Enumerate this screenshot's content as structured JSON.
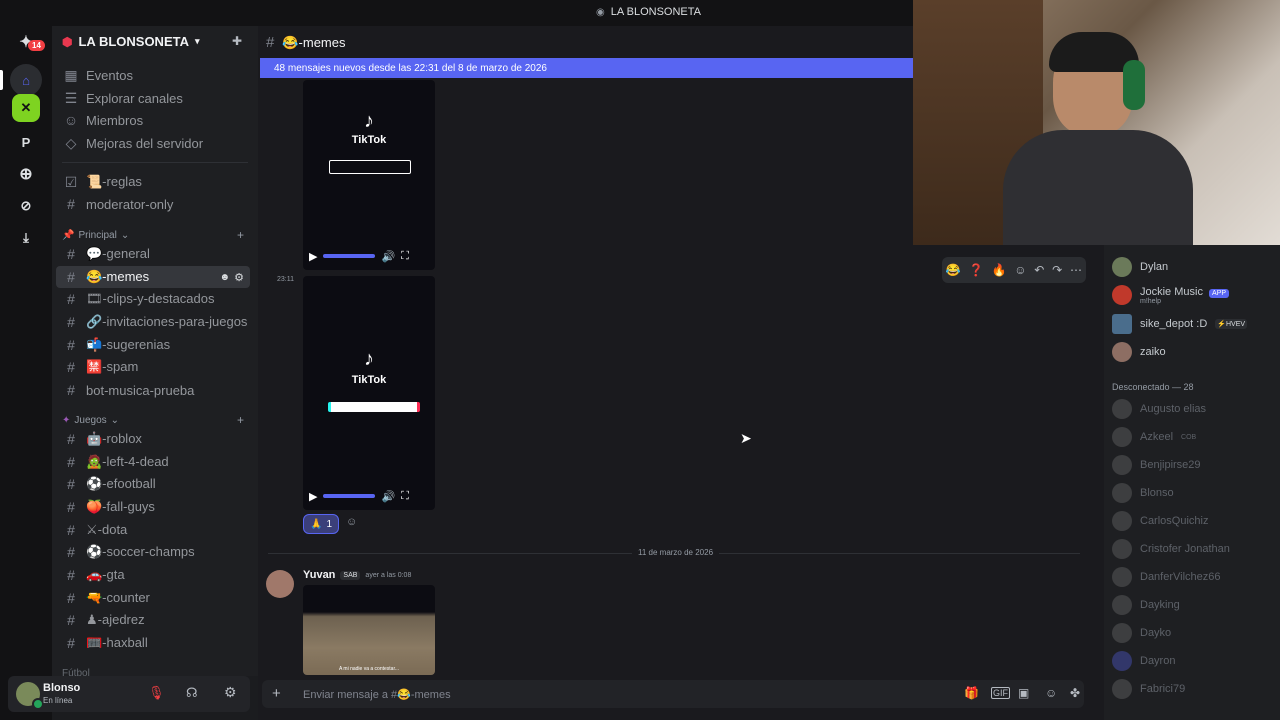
{
  "window": {
    "title": "LA BLONSONETA"
  },
  "servers": {
    "badge": "14",
    "items": [
      "P"
    ]
  },
  "guild": {
    "name": "LA BLONSONETA"
  },
  "nav": [
    {
      "label": "Eventos",
      "icon": "calendar-icon"
    },
    {
      "label": "Explorar canales",
      "icon": "list-icon"
    },
    {
      "label": "Miembros",
      "icon": "members-icon"
    },
    {
      "label": "Mejoras del servidor",
      "icon": "boost-icon"
    }
  ],
  "top_channels": [
    {
      "label": "📜-reglas"
    },
    {
      "label": "moderator-only"
    }
  ],
  "categories": {
    "principal": "Principal",
    "juegos": "Juegos",
    "futbol": "Fútbol"
  },
  "principal_channels": [
    {
      "label": "💬-general"
    },
    {
      "label": "😂-memes"
    },
    {
      "label": "🎞-clips-y-destacados"
    },
    {
      "label": "🔗-invitaciones-para-juegos"
    },
    {
      "label": "📬-sugerenias"
    },
    {
      "label": "🈲-spam"
    },
    {
      "label": "bot-musica-prueba"
    }
  ],
  "juegos_channels": [
    {
      "label": "🤖-roblox"
    },
    {
      "label": "🧟-left-4-dead"
    },
    {
      "label": "⚽-efootball"
    },
    {
      "label": "🍑-fall-guys"
    },
    {
      "label": "⚔-dota"
    },
    {
      "label": "⚽-soccer-champs"
    },
    {
      "label": "🚗-gta"
    },
    {
      "label": "🔫-counter"
    },
    {
      "label": "♟-ajedrez"
    },
    {
      "label": "🥅-haxball"
    }
  ],
  "user": {
    "name": "Blonso",
    "status": "En línea"
  },
  "channel": {
    "name": "😂-memes"
  },
  "banner": "48 mensajes nuevos desde las 22:31 del 8 de marzo de 2026",
  "messages": {
    "video_label": "TikTok",
    "timestamp": "23:11",
    "reaction_emoji": "🙏",
    "reaction_count": "1",
    "date_divider": "11 de marzo de 2026",
    "author": "Yuvan",
    "author_tag": "SAB",
    "author_time": "ayer a las 0:08",
    "caption": "A mi nadie va a contestar..."
  },
  "hover_actions": [
    "😂",
    "❓",
    "🔥"
  ],
  "composer": {
    "placeholder": "Enviar mensaje a #😂-memes"
  },
  "members_online": [
    {
      "name": "Dylan",
      "extra": "",
      "color": "#6b7a5a"
    },
    {
      "name": "Jockie Music",
      "extra": "APP",
      "sub": "m!help",
      "color": "#c0392b"
    },
    {
      "name": "sike_depot :D",
      "extra": "⚡HVEV",
      "color": "#4a6d8c"
    },
    {
      "name": "zaiko",
      "extra": "",
      "color": "#8d6e63"
    }
  ],
  "offline_header": "Desconectado — 28",
  "members_offline": [
    {
      "name": "Augusto elias"
    },
    {
      "name": "Azkeel",
      "extra": "COB"
    },
    {
      "name": "Benjipirse29"
    },
    {
      "name": "Blonso"
    },
    {
      "name": "CarlosQuichiz"
    },
    {
      "name": "Cristofer Jonathan"
    },
    {
      "name": "DanferVilchez66"
    },
    {
      "name": "Dayking"
    },
    {
      "name": "Dayko"
    },
    {
      "name": "Dayron"
    },
    {
      "name": "Fabrici79"
    }
  ]
}
